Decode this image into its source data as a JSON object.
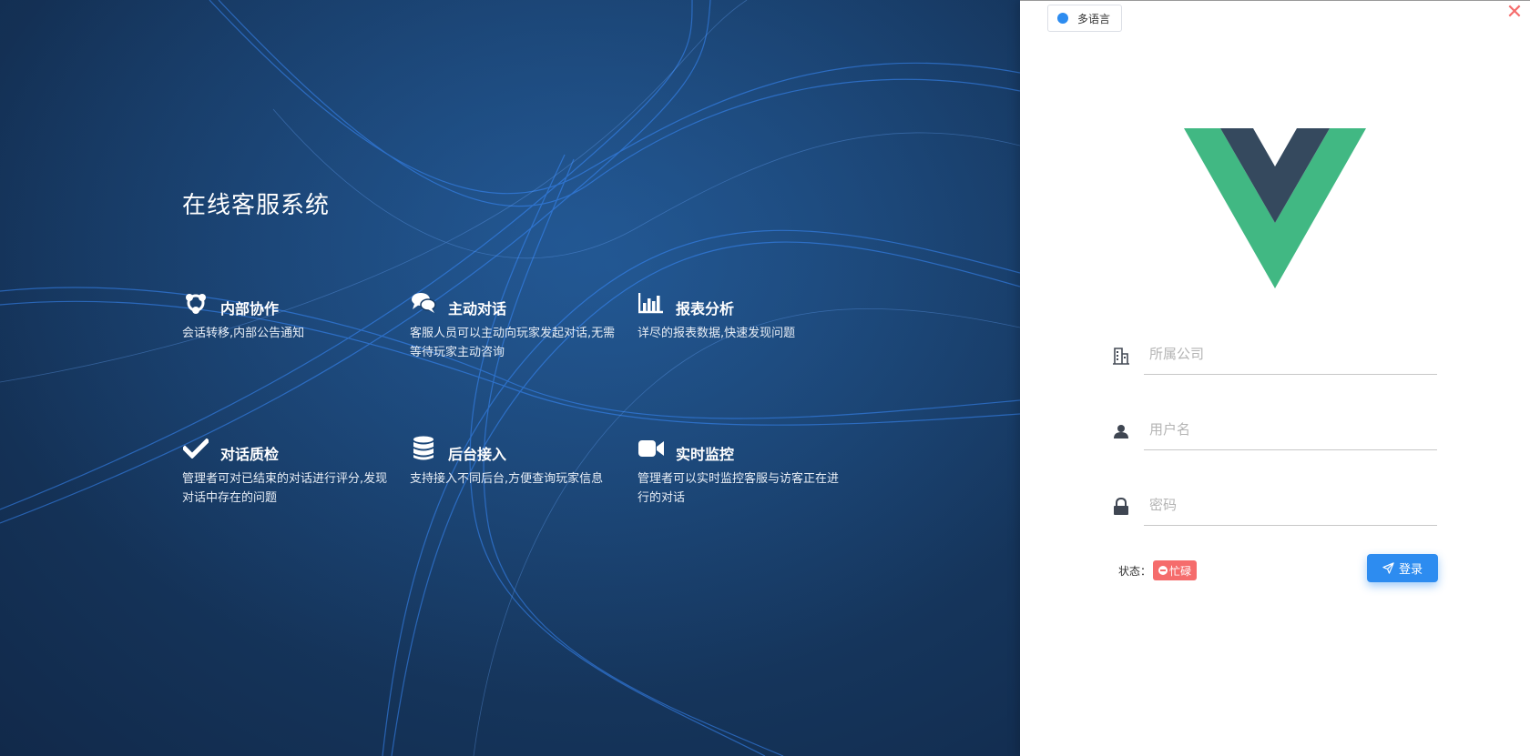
{
  "hero": {
    "title": "在线客服系统",
    "features": [
      {
        "icon": "collaboration-icon",
        "title": "内部协作",
        "desc": "会话转移,内部公告通知"
      },
      {
        "icon": "chat-bubbles-icon",
        "title": "主动对话",
        "desc": "客服人员可以主动向玩家发起对话,无需等待玩家主动咨询"
      },
      {
        "icon": "bar-chart-icon",
        "title": "报表分析",
        "desc": "详尽的报表数据,快速发现问题"
      },
      {
        "icon": "checkmark-icon",
        "title": "对话质检",
        "desc": "管理者可对已结束的对话进行评分,发现对话中存在的问题"
      },
      {
        "icon": "database-icon",
        "title": "后台接入",
        "desc": "支持接入不同后台,方便查询玩家信息"
      },
      {
        "icon": "video-camera-icon",
        "title": "实时监控",
        "desc": "管理者可以实时监控客服与访客正在进行的对话"
      }
    ]
  },
  "panel": {
    "language_button": "多语言",
    "close_icon": "close-icon",
    "logo_icon": "vue-logo",
    "company": {
      "placeholder": "所属公司",
      "value": "",
      "icon": "building-icon"
    },
    "username": {
      "placeholder": "用户名",
      "value": "",
      "icon": "user-icon"
    },
    "password": {
      "placeholder": "密码",
      "value": "",
      "icon": "lock-icon"
    },
    "status_label": "状态：",
    "status_value": "忙碌",
    "login_button": "登录",
    "colors": {
      "accent": "#2d8cf0",
      "busy": "#f56c6c",
      "vue_green": "#41b883",
      "vue_dark": "#35495e",
      "hero_bg": "#173a63"
    }
  }
}
